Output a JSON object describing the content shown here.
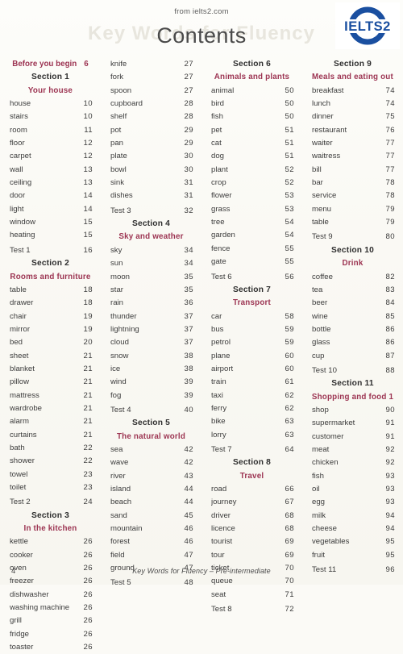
{
  "header": {
    "source": "from ielts2.com",
    "title": "Contents",
    "watermark": "Key Words for Fluency",
    "logo_text": "IELTS2",
    "logo_color": "#1a4fa0"
  },
  "theme": {
    "section_topic_color": "#9c3452",
    "section_number_color": "#2e2e2e",
    "entry_color": "#3c3c3c",
    "page_background": "#faf9f4"
  },
  "footer": {
    "page_number": "4",
    "book_title": "Key Words for Fluency – Pre-intermediate"
  },
  "columns": [
    {
      "blocks": [
        {
          "type": "lead",
          "label": "Before you begin",
          "page": "6"
        },
        {
          "type": "section",
          "number": "Section 1",
          "topic": "Your house"
        },
        {
          "type": "entries",
          "items": [
            {
              "word": "house",
              "page": "10"
            },
            {
              "word": "stairs",
              "page": "10"
            },
            {
              "word": "room",
              "page": "11"
            },
            {
              "word": "floor",
              "page": "12"
            },
            {
              "word": "carpet",
              "page": "12"
            },
            {
              "word": "wall",
              "page": "13"
            },
            {
              "word": "ceiling",
              "page": "13"
            },
            {
              "word": "door",
              "page": "14"
            },
            {
              "word": "light",
              "page": "14"
            },
            {
              "word": "window",
              "page": "15"
            },
            {
              "word": "heating",
              "page": "15"
            }
          ]
        },
        {
          "type": "gap"
        },
        {
          "type": "entries",
          "items": [
            {
              "word": "Test 1",
              "page": "16"
            }
          ]
        },
        {
          "type": "section",
          "number": "Section 2",
          "topic": "Rooms and furniture"
        },
        {
          "type": "entries",
          "items": [
            {
              "word": "table",
              "page": "18"
            },
            {
              "word": "drawer",
              "page": "18"
            },
            {
              "word": "chair",
              "page": "19"
            },
            {
              "word": "mirror",
              "page": "19"
            },
            {
              "word": "bed",
              "page": "20"
            },
            {
              "word": "sheet",
              "page": "21"
            },
            {
              "word": "blanket",
              "page": "21"
            },
            {
              "word": "pillow",
              "page": "21"
            },
            {
              "word": "mattress",
              "page": "21"
            },
            {
              "word": "wardrobe",
              "page": "21"
            },
            {
              "word": "alarm",
              "page": "21"
            },
            {
              "word": "curtains",
              "page": "21"
            },
            {
              "word": "bath",
              "page": "22"
            },
            {
              "word": "shower",
              "page": "22"
            },
            {
              "word": "towel",
              "page": "23"
            },
            {
              "word": "toilet",
              "page": "23"
            }
          ]
        },
        {
          "type": "gap"
        },
        {
          "type": "entries",
          "items": [
            {
              "word": "Test 2",
              "page": "24"
            }
          ]
        },
        {
          "type": "section",
          "number": "Section 3",
          "topic": "In the kitchen"
        },
        {
          "type": "entries",
          "items": [
            {
              "word": "kettle",
              "page": "26"
            },
            {
              "word": "cooker",
              "page": "26"
            },
            {
              "word": "oven",
              "page": "26"
            },
            {
              "word": "freezer",
              "page": "26"
            },
            {
              "word": "dishwasher",
              "page": "26"
            },
            {
              "word": "washing machine",
              "page": "26"
            },
            {
              "word": "grill",
              "page": "26"
            },
            {
              "word": "fridge",
              "page": "26"
            },
            {
              "word": "toaster",
              "page": "26"
            }
          ]
        }
      ]
    },
    {
      "blocks": [
        {
          "type": "entries",
          "items": [
            {
              "word": "knife",
              "page": "27"
            },
            {
              "word": "fork",
              "page": "27"
            },
            {
              "word": "spoon",
              "page": "27"
            },
            {
              "word": "cupboard",
              "page": "28"
            },
            {
              "word": "shelf",
              "page": "28"
            },
            {
              "word": "pot",
              "page": "29"
            },
            {
              "word": "pan",
              "page": "29"
            },
            {
              "word": "plate",
              "page": "30"
            },
            {
              "word": "bowl",
              "page": "30"
            },
            {
              "word": "sink",
              "page": "31"
            },
            {
              "word": "dishes",
              "page": "31"
            }
          ]
        },
        {
          "type": "gap"
        },
        {
          "type": "entries",
          "items": [
            {
              "word": "Test 3",
              "page": "32"
            }
          ]
        },
        {
          "type": "section",
          "number": "Section 4",
          "topic": "Sky and weather"
        },
        {
          "type": "entries",
          "items": [
            {
              "word": "sky",
              "page": "34"
            },
            {
              "word": "sun",
              "page": "34"
            },
            {
              "word": "moon",
              "page": "35"
            },
            {
              "word": "star",
              "page": "35"
            },
            {
              "word": "rain",
              "page": "36"
            },
            {
              "word": "thunder",
              "page": "37"
            },
            {
              "word": "lightning",
              "page": "37"
            },
            {
              "word": "cloud",
              "page": "37"
            },
            {
              "word": "snow",
              "page": "38"
            },
            {
              "word": "ice",
              "page": "38"
            },
            {
              "word": "wind",
              "page": "39"
            },
            {
              "word": "fog",
              "page": "39"
            }
          ]
        },
        {
          "type": "gap"
        },
        {
          "type": "entries",
          "items": [
            {
              "word": "Test 4",
              "page": "40"
            }
          ]
        },
        {
          "type": "section",
          "number": "Section 5",
          "topic": "The natural world"
        },
        {
          "type": "entries",
          "items": [
            {
              "word": "sea",
              "page": "42"
            },
            {
              "word": "wave",
              "page": "42"
            },
            {
              "word": "river",
              "page": "43"
            },
            {
              "word": "island",
              "page": "44"
            },
            {
              "word": "beach",
              "page": "44"
            },
            {
              "word": "sand",
              "page": "45"
            },
            {
              "word": "mountain",
              "page": "46"
            },
            {
              "word": "forest",
              "page": "46"
            },
            {
              "word": "field",
              "page": "47"
            },
            {
              "word": "ground",
              "page": "47"
            }
          ]
        },
        {
          "type": "gap"
        },
        {
          "type": "entries",
          "items": [
            {
              "word": "Test 5",
              "page": "48"
            }
          ]
        }
      ]
    },
    {
      "blocks": [
        {
          "type": "section",
          "number": "Section 6",
          "topic": "Animals and plants"
        },
        {
          "type": "entries",
          "items": [
            {
              "word": "animal",
              "page": "50"
            },
            {
              "word": "bird",
              "page": "50"
            },
            {
              "word": "fish",
              "page": "50"
            },
            {
              "word": "pet",
              "page": "51"
            },
            {
              "word": "cat",
              "page": "51"
            },
            {
              "word": "dog",
              "page": "51"
            },
            {
              "word": "plant",
              "page": "52"
            },
            {
              "word": "crop",
              "page": "52"
            },
            {
              "word": "flower",
              "page": "53"
            },
            {
              "word": "grass",
              "page": "53"
            },
            {
              "word": "tree",
              "page": "54"
            },
            {
              "word": "garden",
              "page": "54"
            },
            {
              "word": "fence",
              "page": "55"
            },
            {
              "word": "gate",
              "page": "55"
            }
          ]
        },
        {
          "type": "gap"
        },
        {
          "type": "entries",
          "items": [
            {
              "word": "Test 6",
              "page": "56"
            }
          ]
        },
        {
          "type": "section",
          "number": "Section 7",
          "topic": "Transport"
        },
        {
          "type": "entries",
          "items": [
            {
              "word": "car",
              "page": "58"
            },
            {
              "word": "bus",
              "page": "59"
            },
            {
              "word": "petrol",
              "page": "59"
            },
            {
              "word": "plane",
              "page": "60"
            },
            {
              "word": "airport",
              "page": "60"
            },
            {
              "word": "train",
              "page": "61"
            },
            {
              "word": "taxi",
              "page": "62"
            },
            {
              "word": "ferry",
              "page": "62"
            },
            {
              "word": "bike",
              "page": "63"
            },
            {
              "word": "lorry",
              "page": "63"
            }
          ]
        },
        {
          "type": "gap"
        },
        {
          "type": "entries",
          "items": [
            {
              "word": "Test 7",
              "page": "64"
            }
          ]
        },
        {
          "type": "section",
          "number": "Section 8",
          "topic": "Travel"
        },
        {
          "type": "entries",
          "items": [
            {
              "word": "road",
              "page": "66"
            },
            {
              "word": "journey",
              "page": "67"
            },
            {
              "word": "driver",
              "page": "68"
            },
            {
              "word": "licence",
              "page": "68"
            },
            {
              "word": "tourist",
              "page": "69"
            },
            {
              "word": "tour",
              "page": "69"
            },
            {
              "word": "ticket",
              "page": "70"
            },
            {
              "word": "queue",
              "page": "70"
            },
            {
              "word": "seat",
              "page": "71"
            }
          ]
        },
        {
          "type": "gap"
        },
        {
          "type": "entries",
          "items": [
            {
              "word": "Test 8",
              "page": "72"
            }
          ]
        }
      ]
    },
    {
      "blocks": [
        {
          "type": "section",
          "number": "Section 9",
          "topic": "Meals and eating out"
        },
        {
          "type": "entries",
          "items": [
            {
              "word": "breakfast",
              "page": "74"
            },
            {
              "word": "lunch",
              "page": "74"
            },
            {
              "word": "dinner",
              "page": "75"
            },
            {
              "word": "restaurant",
              "page": "76"
            },
            {
              "word": "waiter",
              "page": "77"
            },
            {
              "word": "waitress",
              "page": "77"
            },
            {
              "word": "bill",
              "page": "77"
            },
            {
              "word": "bar",
              "page": "78"
            },
            {
              "word": "service",
              "page": "78"
            },
            {
              "word": "menu",
              "page": "79"
            },
            {
              "word": "table",
              "page": "79"
            }
          ]
        },
        {
          "type": "gap"
        },
        {
          "type": "entries",
          "items": [
            {
              "word": "Test 9",
              "page": "80"
            }
          ]
        },
        {
          "type": "section",
          "number": "Section 10",
          "topic": "Drink"
        },
        {
          "type": "entries",
          "items": [
            {
              "word": "coffee",
              "page": "82"
            },
            {
              "word": "tea",
              "page": "83"
            },
            {
              "word": "beer",
              "page": "84"
            },
            {
              "word": "wine",
              "page": "85"
            },
            {
              "word": "bottle",
              "page": "86"
            },
            {
              "word": "glass",
              "page": "86"
            },
            {
              "word": "cup",
              "page": "87"
            }
          ]
        },
        {
          "type": "gap"
        },
        {
          "type": "entries",
          "items": [
            {
              "word": "Test 10",
              "page": "88"
            }
          ]
        },
        {
          "type": "section",
          "number": "Section 11",
          "topic": "Shopping and food 1"
        },
        {
          "type": "entries",
          "items": [
            {
              "word": "shop",
              "page": "90"
            },
            {
              "word": "supermarket",
              "page": "91"
            },
            {
              "word": "customer",
              "page": "91"
            },
            {
              "word": "meat",
              "page": "92"
            },
            {
              "word": "chicken",
              "page": "92"
            },
            {
              "word": "fish",
              "page": "93"
            },
            {
              "word": "oil",
              "page": "93"
            },
            {
              "word": "egg",
              "page": "93"
            },
            {
              "word": "milk",
              "page": "94"
            },
            {
              "word": "cheese",
              "page": "94"
            },
            {
              "word": "vegetables",
              "page": "95"
            },
            {
              "word": "fruit",
              "page": "95"
            }
          ]
        },
        {
          "type": "gap"
        },
        {
          "type": "entries",
          "items": [
            {
              "word": "Test 11",
              "page": "96"
            }
          ]
        }
      ]
    }
  ]
}
